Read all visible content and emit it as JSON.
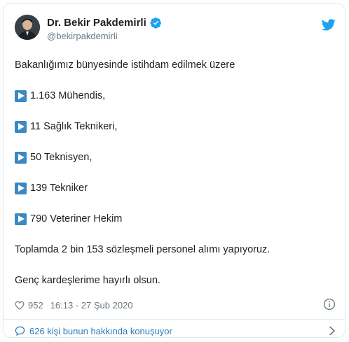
{
  "author": {
    "name": "Dr. Bekir Pakdemirli",
    "handle": "@bekirpakdemirli"
  },
  "tweet": {
    "intro": "Bakanlığımız bünyesinde istihdam edilmek üzere",
    "items": [
      "1.163 Mühendis,",
      "11 Sağlık Teknikeri,",
      "50 Teknisyen,",
      "139 Tekniker",
      "790 Veteriner Hekim"
    ],
    "summary": "Toplamda 2 bin 153 sözleşmeli personel alımı yapıyoruz.",
    "closing": "Genç kardeşlerime hayırlı olsun."
  },
  "footer": {
    "likes": "952",
    "timestamp": "16:13 - 27 Şub 2020"
  },
  "replies": {
    "label": "626 kişi bunun hakkında konuşuyor"
  },
  "colors": {
    "accent": "#1da1f2",
    "link": "#2b7bb9",
    "emoji_blue": "#3b88c3",
    "muted": "#697882",
    "border": "#e1e8ed"
  },
  "icons": [
    "verified-badge-icon",
    "twitter-bird-icon",
    "play-button-emoji-icon",
    "heart-icon",
    "info-icon",
    "speech-bubble-icon",
    "chevron-right-icon"
  ]
}
